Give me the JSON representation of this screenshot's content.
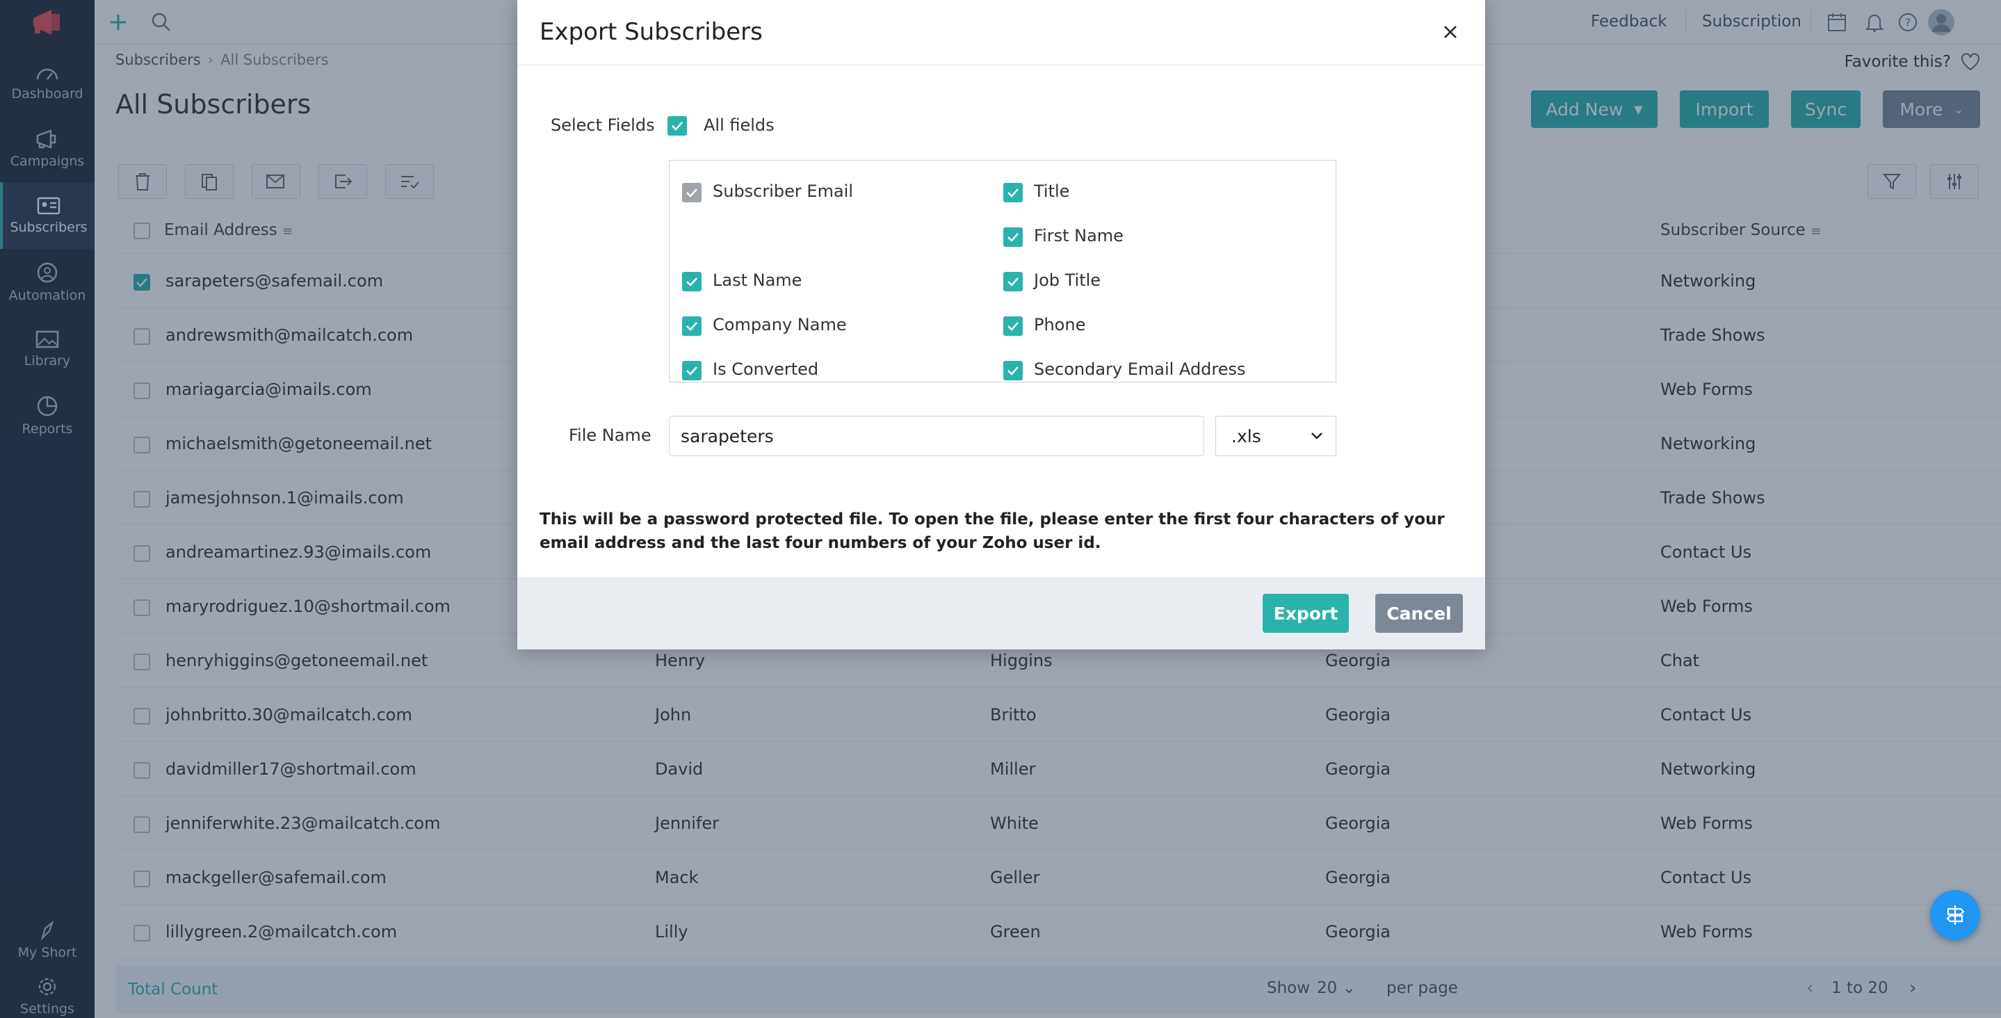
{
  "topbar": {
    "feedback": "Feedback",
    "subscription": "Subscription"
  },
  "sidebar": {
    "items": [
      {
        "label": "Dashboard",
        "icon": "gauge-icon"
      },
      {
        "label": "Campaigns",
        "icon": "megaphone-icon"
      },
      {
        "label": "Subscribers",
        "icon": "contact-card-icon"
      },
      {
        "label": "Automation",
        "icon": "automation-icon"
      },
      {
        "label": "Library",
        "icon": "image-icon"
      },
      {
        "label": "Reports",
        "icon": "pie-chart-icon"
      }
    ],
    "bottom": [
      {
        "label": "My Short",
        "icon": "shortcut-icon"
      },
      {
        "label": "Settings",
        "icon": "gear-icon"
      }
    ]
  },
  "main": {
    "breadcrumb": {
      "parent": "Subscribers",
      "current": "All Subscribers"
    },
    "title": "All Subscribers",
    "favorite": "Favorite this?",
    "buttons": {
      "add_new": "Add New",
      "import": "Import",
      "sync": "Sync",
      "more": "More"
    },
    "columns": {
      "email": "Email Address",
      "source": "Subscriber Source"
    },
    "rows": [
      {
        "email": "sarapeters@safemail.com",
        "first": "",
        "last": "",
        "state": "",
        "source": "Networking",
        "checked": true
      },
      {
        "email": "andrewsmith@mailcatch.com",
        "first": "",
        "last": "",
        "state": "",
        "source": "Trade Shows"
      },
      {
        "email": "mariagarcia@imails.com",
        "first": "",
        "last": "",
        "state": "",
        "source": "Web Forms"
      },
      {
        "email": "michaelsmith@getoneemail.net",
        "first": "",
        "last": "",
        "state": "",
        "source": "Networking"
      },
      {
        "email": "jamesjohnson.1@imails.com",
        "first": "",
        "last": "",
        "state": "",
        "source": "Trade Shows"
      },
      {
        "email": "andreamartinez.93@imails.com",
        "first": "",
        "last": "",
        "state": "",
        "source": "Contact Us"
      },
      {
        "email": "maryrodriguez.10@shortmail.com",
        "first": "",
        "last": "",
        "state": "",
        "source": "Web Forms"
      },
      {
        "email": "henryhiggins@getoneemail.net",
        "first": "Henry",
        "last": "Higgins",
        "state": "Georgia",
        "source": "Chat"
      },
      {
        "email": "johnbritto.30@mailcatch.com",
        "first": "John",
        "last": "Britto",
        "state": "Georgia",
        "source": "Contact Us"
      },
      {
        "email": "davidmiller17@shortmail.com",
        "first": "David",
        "last": "Miller",
        "state": "Georgia",
        "source": "Networking"
      },
      {
        "email": "jenniferwhite.23@mailcatch.com",
        "first": "Jennifer",
        "last": "White",
        "state": "Georgia",
        "source": "Web Forms"
      },
      {
        "email": "mackgeller@safemail.com",
        "first": "Mack",
        "last": "Geller",
        "state": "Georgia",
        "source": "Contact Us"
      },
      {
        "email": "lillygreen.2@mailcatch.com",
        "first": "Lilly",
        "last": "Green",
        "state": "Georgia",
        "source": "Web Forms"
      }
    ],
    "footer": {
      "total_count": "Total Count",
      "show": "Show",
      "per_page_value": "20",
      "per_page": "per page",
      "range": "1 to 20"
    }
  },
  "modal": {
    "title": "Export Subscribers",
    "select_fields_label": "Select Fields",
    "all_fields": "All fields",
    "fields_left": [
      "Subscriber Email",
      "",
      "Last Name",
      "Company Name",
      "Is Converted"
    ],
    "fields_right": [
      "Title",
      "First Name",
      "Job Title",
      "Phone",
      "Secondary Email Address"
    ],
    "file_name_label": "File Name",
    "file_name_value": "sarapeters",
    "extension": ".xls",
    "note": "This will be a password protected file. To open the file, please enter the first four characters of your email address and the last four numbers of your Zoho user id.",
    "export_button": "Export",
    "cancel_button": "Cancel"
  },
  "colors": {
    "accent": "#2ab3ac",
    "sidebar": "#1f2a3a",
    "cancel": "#7d8897",
    "fab": "#2196f3"
  }
}
